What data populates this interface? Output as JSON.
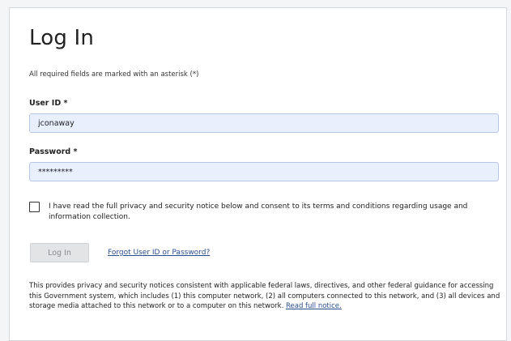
{
  "title": "Log In",
  "required_note": "All required fields are marked with an asterisk (*)",
  "user_id": {
    "label": "User ID *",
    "value": "jconaway"
  },
  "password": {
    "label": "Password *",
    "value": "*********"
  },
  "consent": {
    "checked": false,
    "text": "I have read the full privacy and security notice below and consent to its terms and conditions regarding usage and information collection."
  },
  "login_button": "Log In",
  "forgot_link": "Forgot User ID or Password?",
  "notice": {
    "text": "This provides privacy and security notices consistent with applicable federal laws, directives, and other federal guidance for accessing this Government system, which includes (1) this computer network, (2) all computers connected to this network, and (3) all devices and storage media attached to this network or to a computer on this network. ",
    "link": "Read full notice."
  },
  "colors": {
    "input_background": "#e8f0fd",
    "link": "#2a4d8f",
    "disabled_button": "#e3e4e6"
  }
}
